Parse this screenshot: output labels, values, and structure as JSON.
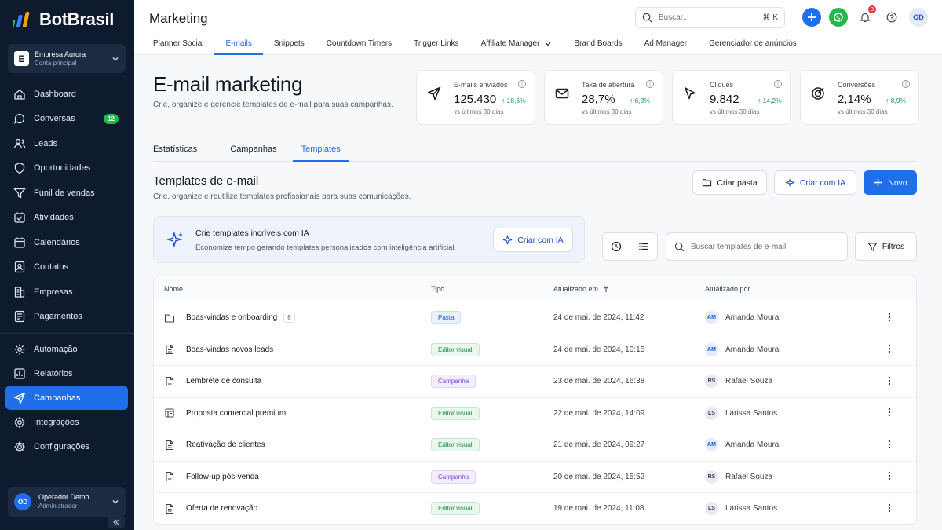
{
  "app": {
    "name": "BotBrasil"
  },
  "workspace": {
    "badge": "E",
    "name": "Empresa Aurora",
    "sub": "Conta principal"
  },
  "nav": [
    {
      "label": "Dashboard",
      "icon": "dashboard-icon"
    },
    {
      "label": "Conversas",
      "icon": "chat-icon",
      "badge": "12"
    },
    {
      "label": "Leads",
      "icon": "leads-icon"
    },
    {
      "label": "Oportunidades",
      "icon": "opportunity-icon"
    },
    {
      "label": "Funil de vendas",
      "icon": "funnel-icon"
    },
    {
      "label": "Atividades",
      "icon": "calendar-check-icon"
    },
    {
      "label": "Calendários",
      "icon": "calendar-icon"
    },
    {
      "label": "Contatos",
      "icon": "contacts-icon"
    },
    {
      "label": "Empresas",
      "icon": "building-icon"
    },
    {
      "label": "Pagamentos",
      "icon": "payment-icon"
    }
  ],
  "nav2": [
    {
      "label": "Automação",
      "icon": "automation-icon"
    },
    {
      "label": "Relatórios",
      "icon": "reports-icon"
    },
    {
      "label": "Campanhas",
      "icon": "send-icon",
      "active": true
    },
    {
      "label": "Integrações",
      "icon": "integrations-icon"
    },
    {
      "label": "Configurações",
      "icon": "gear-icon"
    }
  ],
  "user": {
    "initials": "OD",
    "name": "Operador Demo",
    "role": "Administrador"
  },
  "topbar": {
    "title": "Marketing",
    "search_placeholder": "Buscar...",
    "search_kbd": "⌘ K",
    "notif_count": "3",
    "avatar": "OD"
  },
  "subtabs": [
    "Planner Social",
    "E-mails",
    "Snippets",
    "Countdown Timers",
    "Trigger Links",
    "Affiliate Manager",
    "Brand Boards",
    "Ad Manager",
    "Gerenciador de anúncios"
  ],
  "hero": {
    "title": "E-mail marketing",
    "sub": "Crie, organize e gerencie templates de e-mail para suas campanhas."
  },
  "kpis": [
    {
      "label": "E-mails enviados",
      "value": "125.430",
      "delta": "↑ 18,6%",
      "note": "vs últimos 30 dias",
      "icon": "send-icon"
    },
    {
      "label": "Taxa de abertura",
      "value": "28,7%",
      "delta": "↑ 6,3%",
      "note": "vs últimos 30 dias",
      "icon": "mail-icon"
    },
    {
      "label": "Cliques",
      "value": "9.842",
      "delta": "↑ 14,2%",
      "note": "vs últimos 30 dias",
      "icon": "cursor-icon"
    },
    {
      "label": "Conversões",
      "value": "2,14%",
      "delta": "↑ 8,9%",
      "note": "vs últimos 30 dias",
      "icon": "target-icon"
    }
  ],
  "tabs": [
    "Estatísticas",
    "Campanhas",
    "Templates"
  ],
  "section": {
    "title": "Templates de e-mail",
    "sub": "Crie, organize e reutilize templates profissionais para suas comunicações."
  },
  "buttons": {
    "folder": "Criar pasta",
    "ai": "Criar com IA",
    "new": "Novo",
    "filters": "Filtros"
  },
  "ai_banner": {
    "title": "Crie templates incríveis com IA",
    "sub": "Economize tempo gerando templates personalizados com inteligência artificial.",
    "button": "Criar com IA"
  },
  "search_templates": "Buscar templates de e-mail",
  "table": {
    "headers": {
      "name": "Nome",
      "type": "Tipo",
      "updated": "Atualizado em",
      "by": "Atualizado por"
    },
    "rows": [
      {
        "name": "Boas-vindas e onboarding",
        "count": "6",
        "icon": "folder-icon",
        "type": "Pasta",
        "kind": "pasta",
        "date": "24 de mai. de 2024, 11:42",
        "initials": "AM",
        "user": "Amanda Moura"
      },
      {
        "name": "Boas-vindas novos leads",
        "icon": "document-icon",
        "type": "Editor visual",
        "kind": "editor",
        "date": "24 de mai. de 2024, 10:15",
        "initials": "AM",
        "user": "Amanda Moura"
      },
      {
        "name": "Lembrete de consulta",
        "icon": "document-icon",
        "type": "Campanha",
        "kind": "campanha",
        "date": "23 de mai. de 2024, 16:38",
        "initials": "RS",
        "user": "Rafael Souza"
      },
      {
        "name": "Proposta comercial premium",
        "icon": "layout-icon",
        "type": "Editor visual",
        "kind": "editor",
        "date": "22 de mai. de 2024, 14:09",
        "initials": "LS",
        "user": "Larissa Santos"
      },
      {
        "name": "Reativação de clientes",
        "icon": "document-icon",
        "type": "Editor visual",
        "kind": "editor",
        "date": "21 de mai. de 2024, 09:27",
        "initials": "AM",
        "user": "Amanda Moura"
      },
      {
        "name": "Follow-up pós-venda",
        "icon": "document-icon",
        "type": "Campanha",
        "kind": "campanha",
        "date": "20 de mai. de 2024, 15:52",
        "initials": "RS",
        "user": "Rafael Souza"
      },
      {
        "name": "Oferta de renovação",
        "icon": "document-icon",
        "type": "Editor visual",
        "kind": "editor",
        "date": "19 de mai. de 2024, 11:08",
        "initials": "LS",
        "user": "Larissa Santos"
      }
    ]
  },
  "colors": {
    "primary": "#1f6feb",
    "sidebar": "#0e1a2e",
    "success": "#1e9a4a",
    "whatsapp": "#22b84c"
  }
}
